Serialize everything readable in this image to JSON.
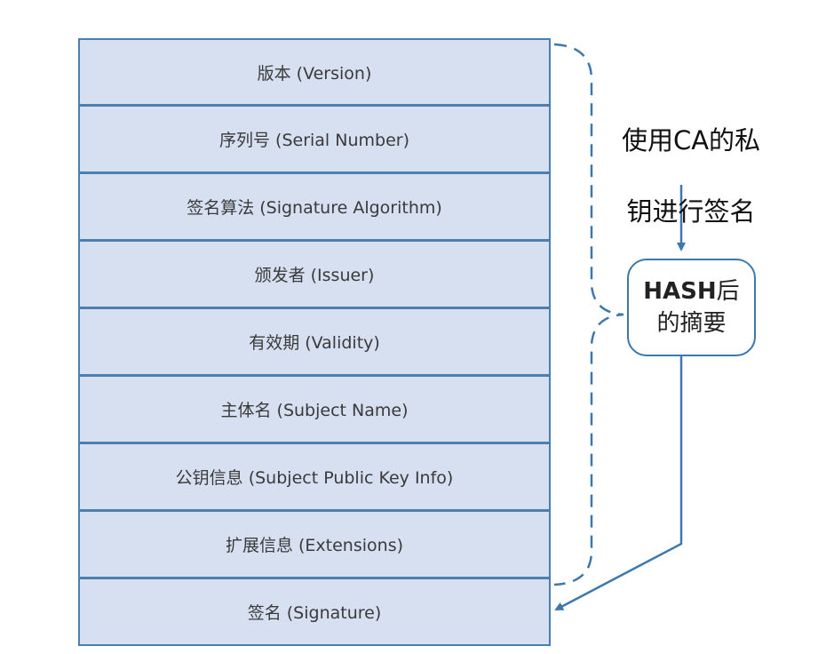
{
  "fields": [
    "版本 (Version)",
    "序列号 (Serial Number)",
    "签名算法 (Signature Algorithm)",
    "颁发者 (Issuer)",
    "有效期 (Validity)",
    "主体名 (Subject Name)",
    "公钥信息 (Subject Public Key Info)",
    "扩展信息 (Extensions)",
    "签名 (Signature)"
  ],
  "note": {
    "line1": "使用CA的私",
    "line2": "钥进行签名"
  },
  "hash": {
    "line1_bold": "HASH",
    "line1_rest": "后",
    "line2": "的摘要"
  },
  "colors": {
    "row_fill": "#d6e0f1",
    "border": "#4a7fb0",
    "connector": "#3d78ad"
  }
}
